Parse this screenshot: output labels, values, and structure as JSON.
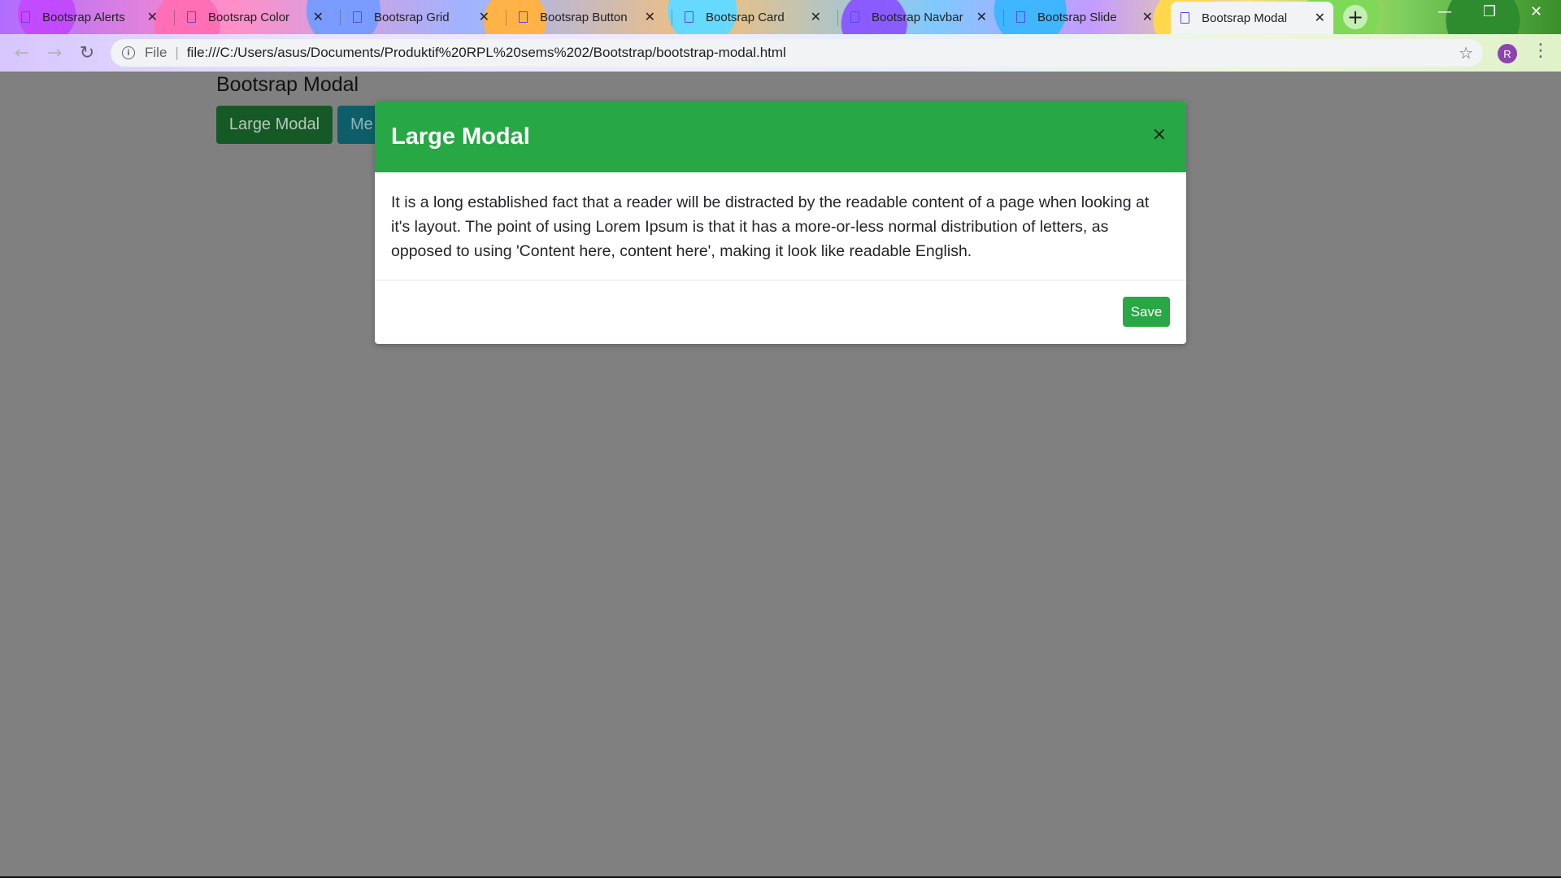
{
  "browser": {
    "tabs": [
      {
        "label": "Bootsrap Alerts"
      },
      {
        "label": "Bootsrap Color"
      },
      {
        "label": "Bootsrap Grid"
      },
      {
        "label": "Bootsrap Button"
      },
      {
        "label": "Bootsrap Card"
      },
      {
        "label": "Bootsrap Navbar"
      },
      {
        "label": "Bootsrap Slide"
      },
      {
        "label": "Bootsrap Modal",
        "active": true
      }
    ],
    "close_glyph": "✕",
    "new_tab_glyph": "+",
    "address": {
      "scheme_label": "File",
      "url": "file:///C:/Users/asus/Documents/Produktif%20RPL%20sems%202/Bootstrap/bootstrap-modal.html"
    },
    "profile_initial": "R"
  },
  "page": {
    "title": "Bootsrap Modal",
    "buttons": {
      "large_modal": "Large Modal",
      "medium_modal_partial": "Me"
    }
  },
  "modal": {
    "title": "Large Modal",
    "close_glyph": "×",
    "body": "It is a long established fact that a reader will be distracted by the readable content of a page when looking at it's layout. The point of using Lorem Ipsum is that it has a more-or-less normal distribution of letters, as opposed to using 'Content here, content here', making it look like readable English.",
    "save_label": "Save"
  },
  "icons": [
    "doc-icon",
    "close-icon",
    "plus-icon",
    "back-icon",
    "forward-icon",
    "reload-icon",
    "info-icon",
    "star-icon",
    "menu-icon",
    "minimize-icon",
    "restore-icon"
  ],
  "colors": {
    "modal_header": "#28a745",
    "backdrop": "#808080",
    "save_button": "#28a745"
  }
}
